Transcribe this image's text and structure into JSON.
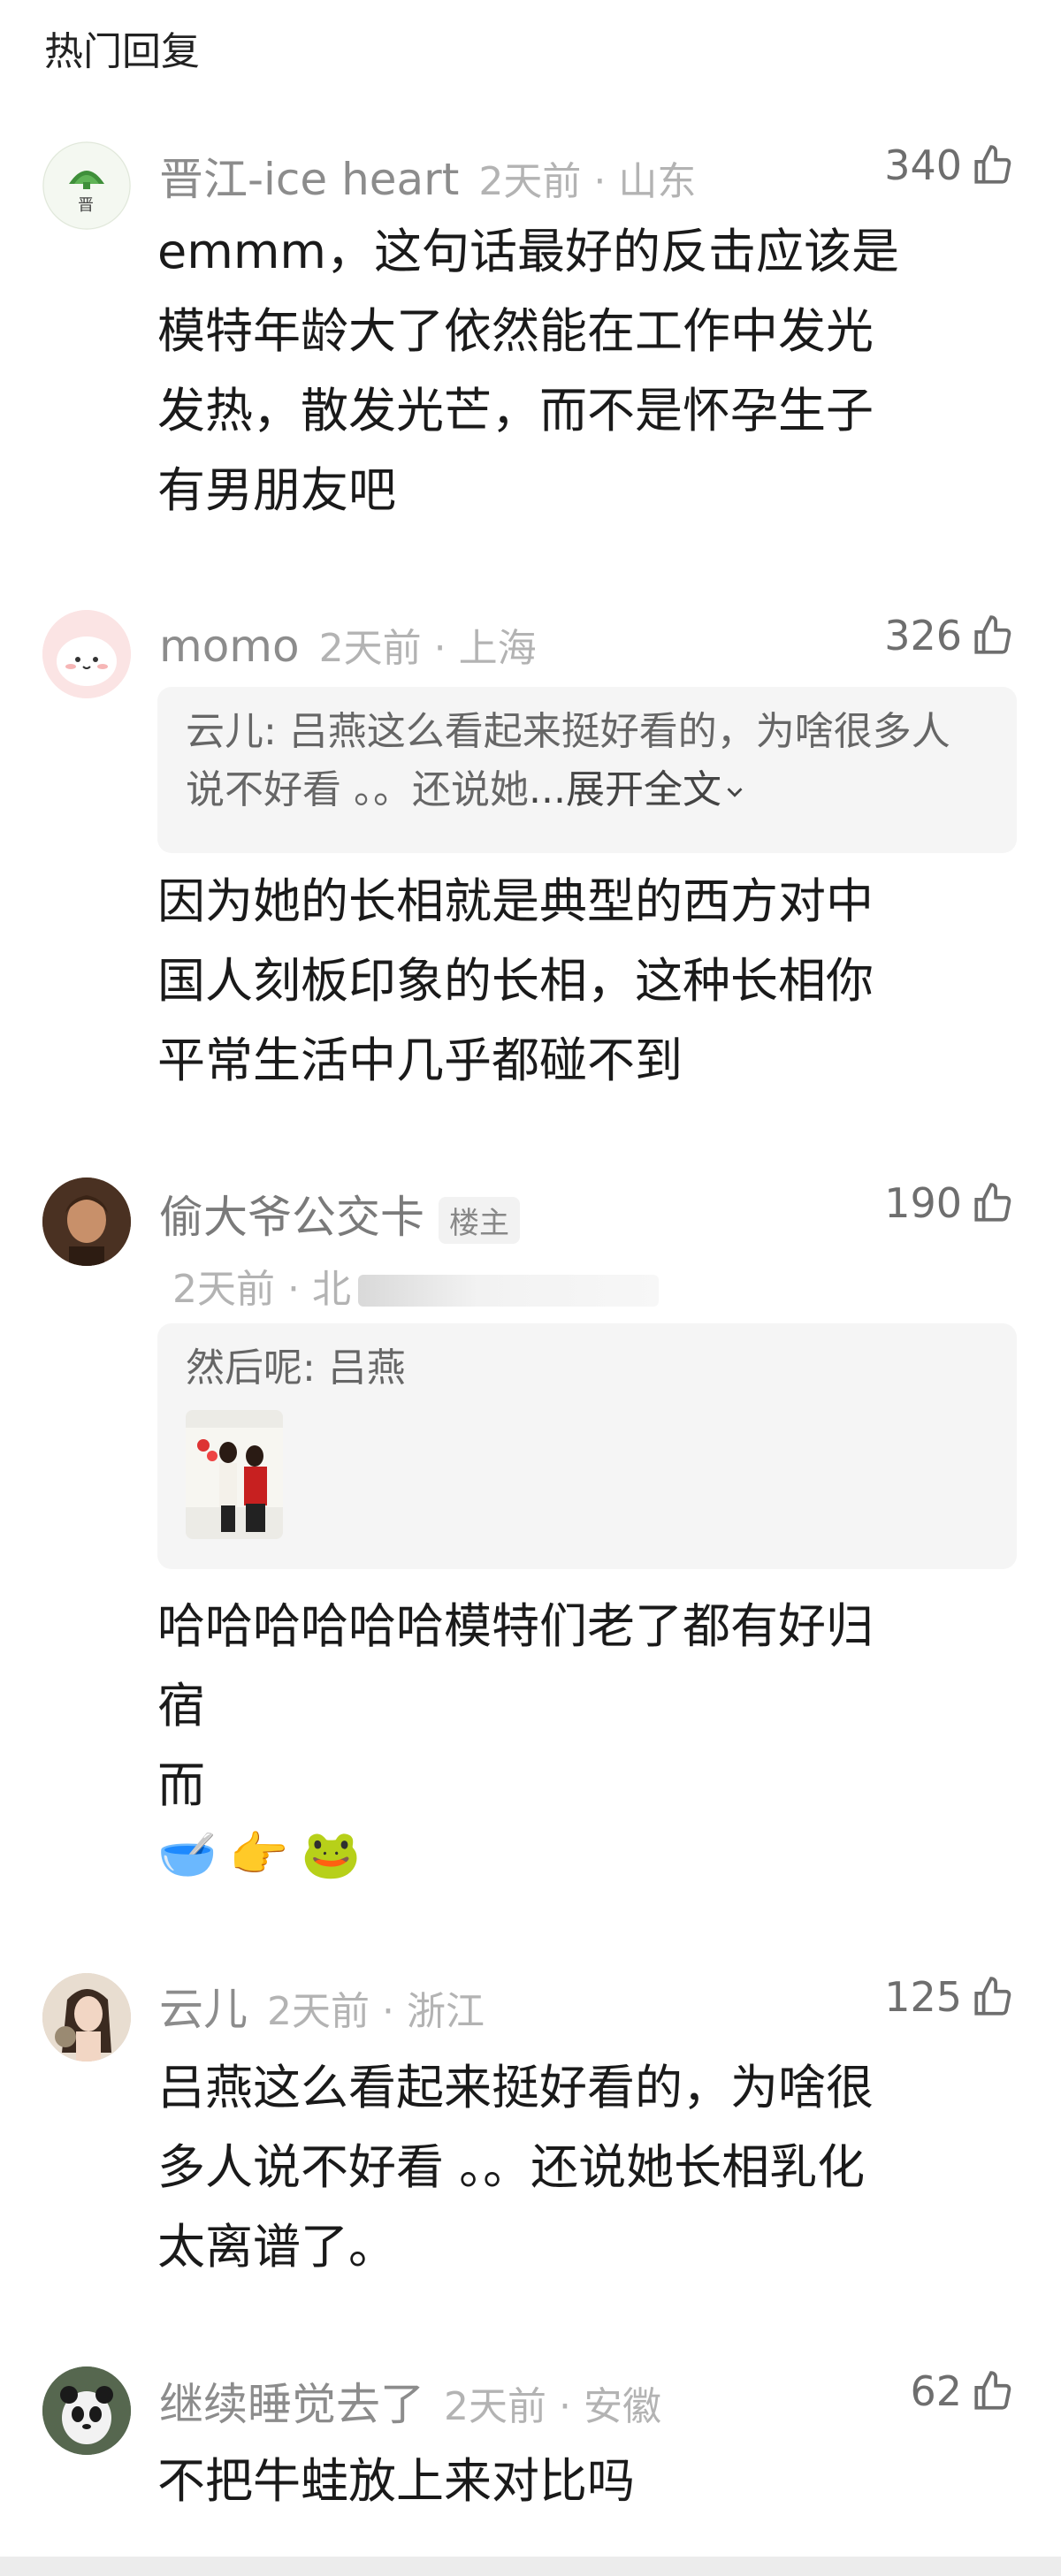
{
  "section_title": "热门回复",
  "comments": [
    {
      "user": "晋江-ice heart",
      "time": "2天前",
      "location": "山东",
      "likes": "340",
      "text": "emmm，这句话最好的反击应该是\n模特年龄大了依然能在工作中发光\n发热，散发光芒，而不是怀孕生子\n有男朋友吧"
    },
    {
      "user": "momo",
      "time": "2天前",
      "location": "上海",
      "likes": "326",
      "quote_author": "云儿",
      "quote_text": "吕燕这么看起来挺好看的，为啥很多人说不好看 。。还说她",
      "quote_more": "...展开全文",
      "text": "因为她的长相就是典型的西方对中\n国人刻板印象的长相，这种长相你\n平常生活中几乎都碰不到"
    },
    {
      "user": "偷大爷公交卡",
      "badge": "楼主",
      "time": "2天前",
      "location": "北",
      "likes": "190",
      "quote_author": "然后呢",
      "quote_text": "吕燕",
      "text": "哈哈哈哈哈哈模特们老了都有好归\n宿\n而"
    },
    {
      "user": "云儿",
      "time": "2天前",
      "location": "浙江",
      "likes": "125",
      "text": "吕燕这么看起来挺好看的，为啥很\n多人说不好看 。。还说她长相乳化\n太离谱了。"
    },
    {
      "user": "继续睡觉去了",
      "time": "2天前",
      "location": "安徽",
      "likes": "62",
      "text": "不把牛蛙放上来对比吗"
    }
  ],
  "emojis": [
    "🥣",
    "👉",
    "🐸"
  ],
  "icons": {
    "like": "thumbs-up-icon",
    "expand": "chevron-down-icon"
  },
  "colors": {
    "meta": "#b3b3b3",
    "name": "#8c8c8c",
    "quote_bg": "#f5f5f5"
  }
}
